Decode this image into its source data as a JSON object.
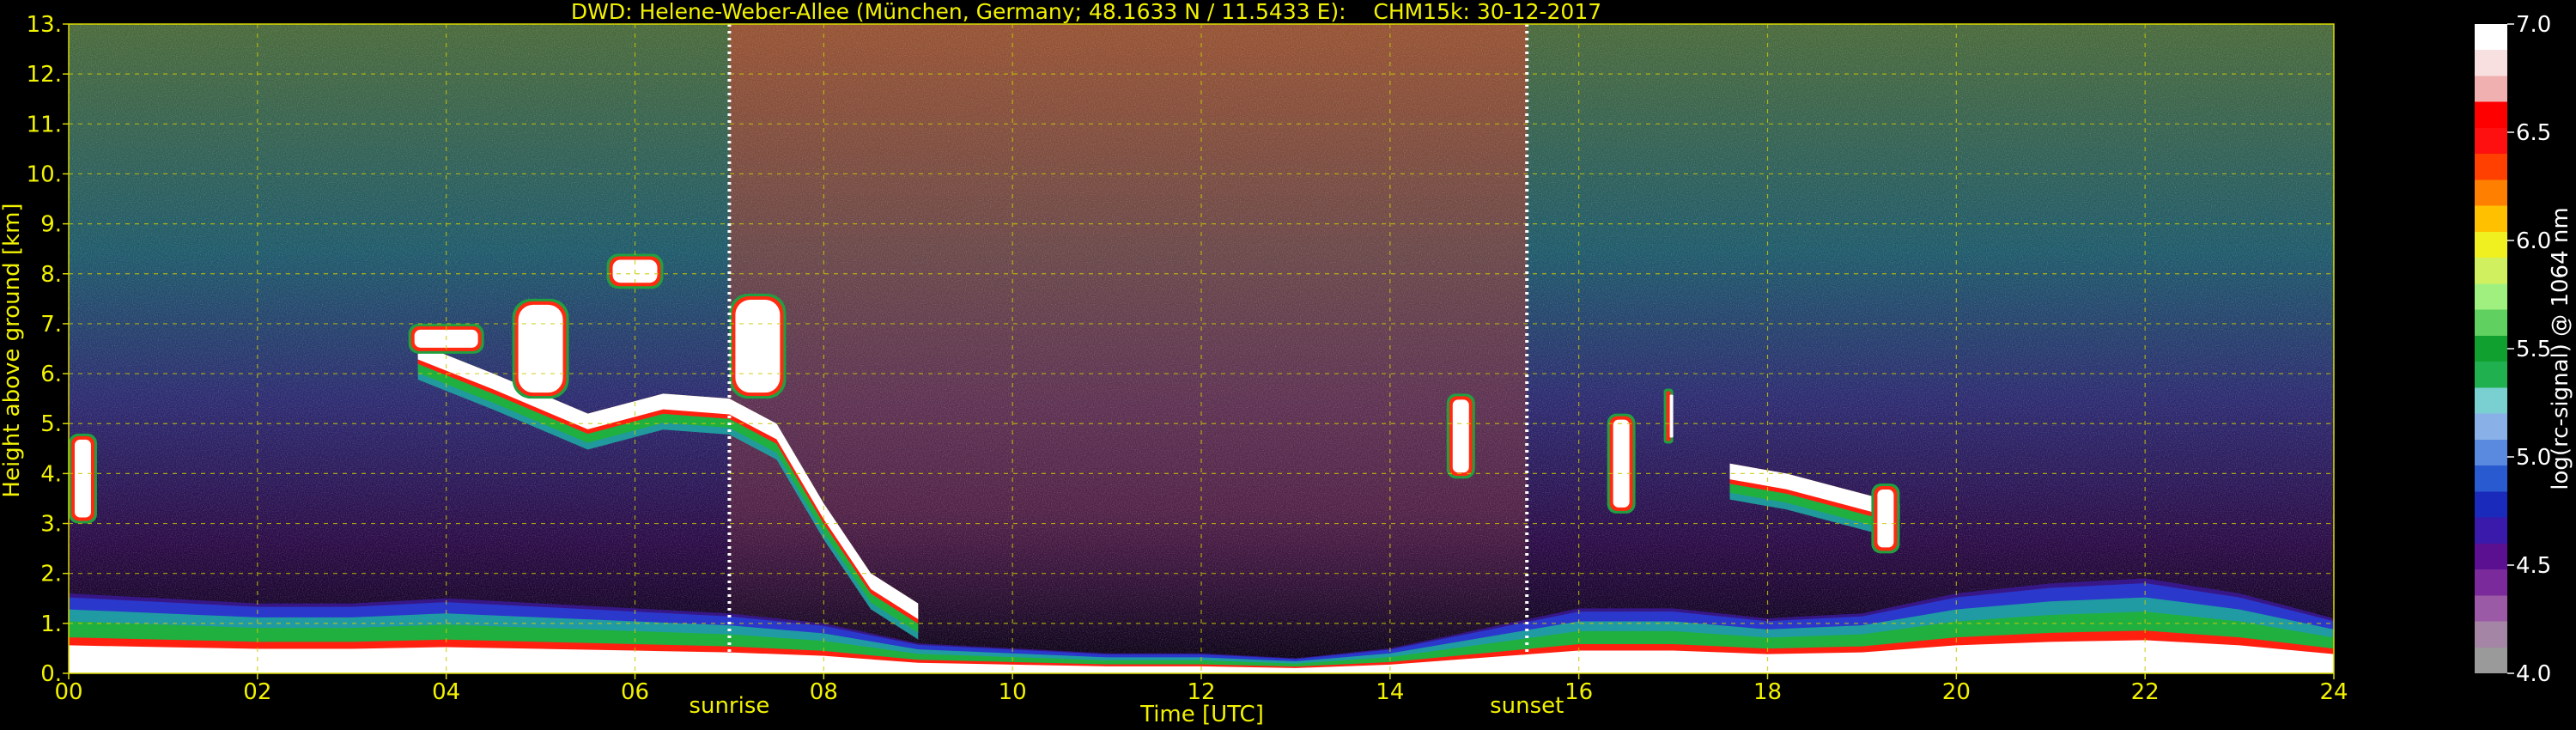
{
  "chart_data": {
    "type": "heatmap",
    "title": "DWD: Helene-Weber-Allee (München, Germany; 48.1633 N / 11.5433 E):    CHM15k: 30-12-2017",
    "xlabel": "Time [UTC]",
    "ylabel": "Height above ground [km]",
    "xlim": [
      0,
      24
    ],
    "ylim": [
      0,
      13
    ],
    "grid": true,
    "x_ticks": [
      "00",
      "02",
      "04",
      "06",
      "08",
      "10",
      "12",
      "14",
      "16",
      "18",
      "20",
      "22",
      "24"
    ],
    "y_ticks": [
      "0.",
      "1.",
      "2.",
      "3.",
      "4.",
      "5.",
      "6.",
      "7.",
      "8.",
      "9.",
      "10.",
      "11.",
      "12.",
      "13."
    ],
    "markers": [
      {
        "label": "sunrise",
        "x": 7.0
      },
      {
        "label": "sunset",
        "x": 15.45
      }
    ],
    "colorbar": {
      "label": "log(rc-signal) @ 1064 nm",
      "range": [
        4.0,
        7.0
      ],
      "ticks": [
        "4.0",
        "4.5",
        "5.0",
        "5.5",
        "6.0",
        "6.5",
        "7.0"
      ],
      "colors": [
        "#9a9a9a",
        "#a585a5",
        "#9a5aa5",
        "#7a2a9a",
        "#5a1090",
        "#3a1aaa",
        "#1a2aba",
        "#2a5ad0",
        "#5a8ae0",
        "#8ab0e8",
        "#7ad0d0",
        "#20b050",
        "#10a030",
        "#60d060",
        "#a0f080",
        "#d0f060",
        "#f0f020",
        "#ffc000",
        "#ff8000",
        "#ff4000",
        "#ff1010",
        "#ff0000",
        "#f0b0b0",
        "#f8e0e0",
        "#ffffff"
      ]
    },
    "layers": [
      {
        "name": "boundary layer",
        "x": [
          0,
          1,
          2,
          3,
          4,
          5,
          6,
          7,
          8,
          9,
          10,
          11,
          12,
          13,
          14,
          15,
          16,
          17,
          18,
          19,
          20,
          21,
          22,
          23,
          24
        ],
        "top_km": [
          1.6,
          1.5,
          1.4,
          1.4,
          1.5,
          1.4,
          1.3,
          1.2,
          1.0,
          0.6,
          0.5,
          0.4,
          0.4,
          0.3,
          0.5,
          0.9,
          1.3,
          1.3,
          1.1,
          1.2,
          1.6,
          1.8,
          1.9,
          1.6,
          1.1
        ]
      },
      {
        "name": "elevated aerosol layer",
        "x": [
          3.7,
          4.5,
          5.5,
          6.3,
          7.0,
          7.5,
          8.0,
          8.5,
          9.0
        ],
        "top_km": [
          6.6,
          6.0,
          5.2,
          5.6,
          5.5,
          5.0,
          3.4,
          2.0,
          1.4
        ]
      },
      {
        "name": "cloud layer",
        "x": [
          17.6,
          18.2,
          18.8,
          19.4
        ],
        "top_km": [
          4.2,
          4.0,
          3.7,
          3.4
        ]
      }
    ],
    "clouds": [
      {
        "x": [
          0.0,
          0.3
        ],
        "height_km": [
          3.0,
          4.8
        ]
      },
      {
        "x": [
          3.6,
          4.4
        ],
        "height_km": [
          6.4,
          7.0
        ]
      },
      {
        "x": [
          4.7,
          5.3
        ],
        "height_km": [
          5.5,
          7.5
        ]
      },
      {
        "x": [
          5.7,
          6.3
        ],
        "height_km": [
          7.7,
          8.4
        ]
      },
      {
        "x": [
          7.0,
          7.6
        ],
        "height_km": [
          5.5,
          7.6
        ]
      },
      {
        "x": [
          14.6,
          14.9
        ],
        "height_km": [
          3.9,
          5.6
        ]
      },
      {
        "x": [
          16.3,
          16.6
        ],
        "height_km": [
          3.2,
          5.2
        ]
      },
      {
        "x": [
          16.9,
          17.0
        ],
        "height_km": [
          4.6,
          5.7
        ]
      },
      {
        "x": [
          19.1,
          19.4
        ],
        "height_km": [
          2.4,
          3.8
        ]
      }
    ]
  }
}
